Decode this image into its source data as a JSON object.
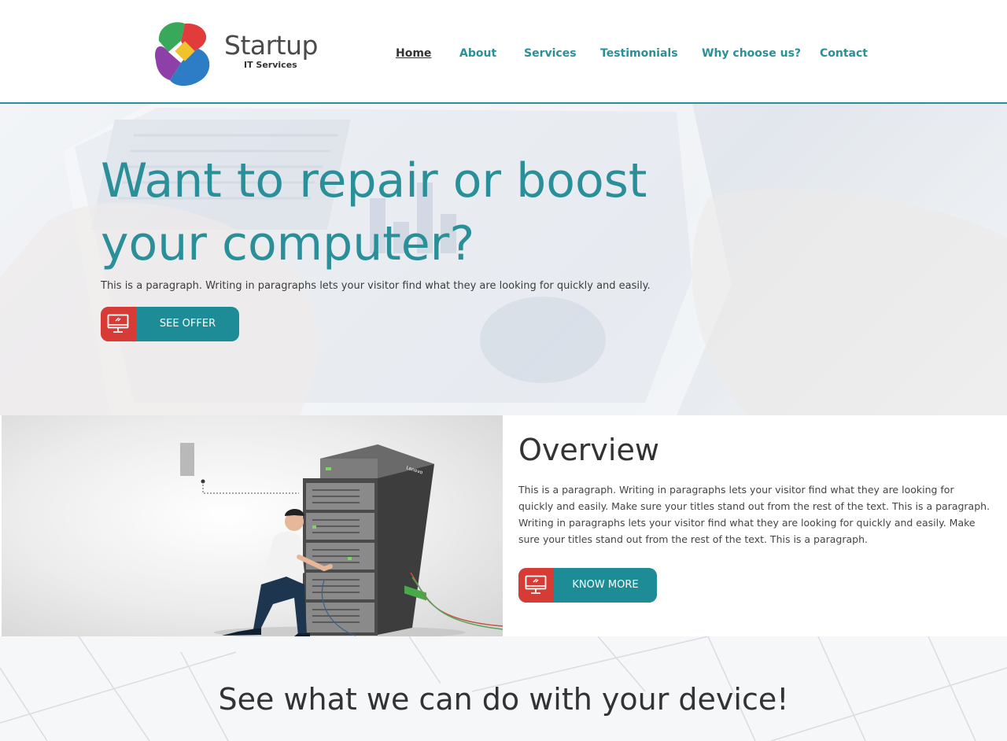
{
  "brand": {
    "name": "Startup",
    "tagline": "IT Services",
    "colors": {
      "accent": "#2a8f98",
      "button": "#1e8c97",
      "icon_bg": "#d63b35"
    }
  },
  "nav": {
    "items": [
      {
        "label": "Home",
        "active": true
      },
      {
        "label": "About"
      },
      {
        "label": "Services"
      },
      {
        "label": "Testimonials"
      },
      {
        "label": "Why choose us?"
      },
      {
        "label": "Contact"
      }
    ]
  },
  "hero": {
    "title": "Want to repair or boost your computer?",
    "paragraph": "This is a paragraph. Writing in paragraphs lets your visitor find what they are looking for quickly and easily.",
    "button_label": "SEE OFFER",
    "button_icon": "monitor-icon"
  },
  "overview": {
    "title": "Overview",
    "paragraph": "This is a paragraph. Writing in paragraphs lets your visitor find what they are looking for quickly and easily. Make sure your titles stand out from the rest of the text. This is a paragraph. Writing in paragraphs lets your visitor find what they are looking for quickly and easily. Make sure your titles stand out from the rest of the text. This is a paragraph.",
    "button_label": "KNOW MORE",
    "button_icon": "monitor-icon",
    "rack_brand": "Lenovo"
  },
  "services": {
    "title": "See what we can do with your device!"
  }
}
